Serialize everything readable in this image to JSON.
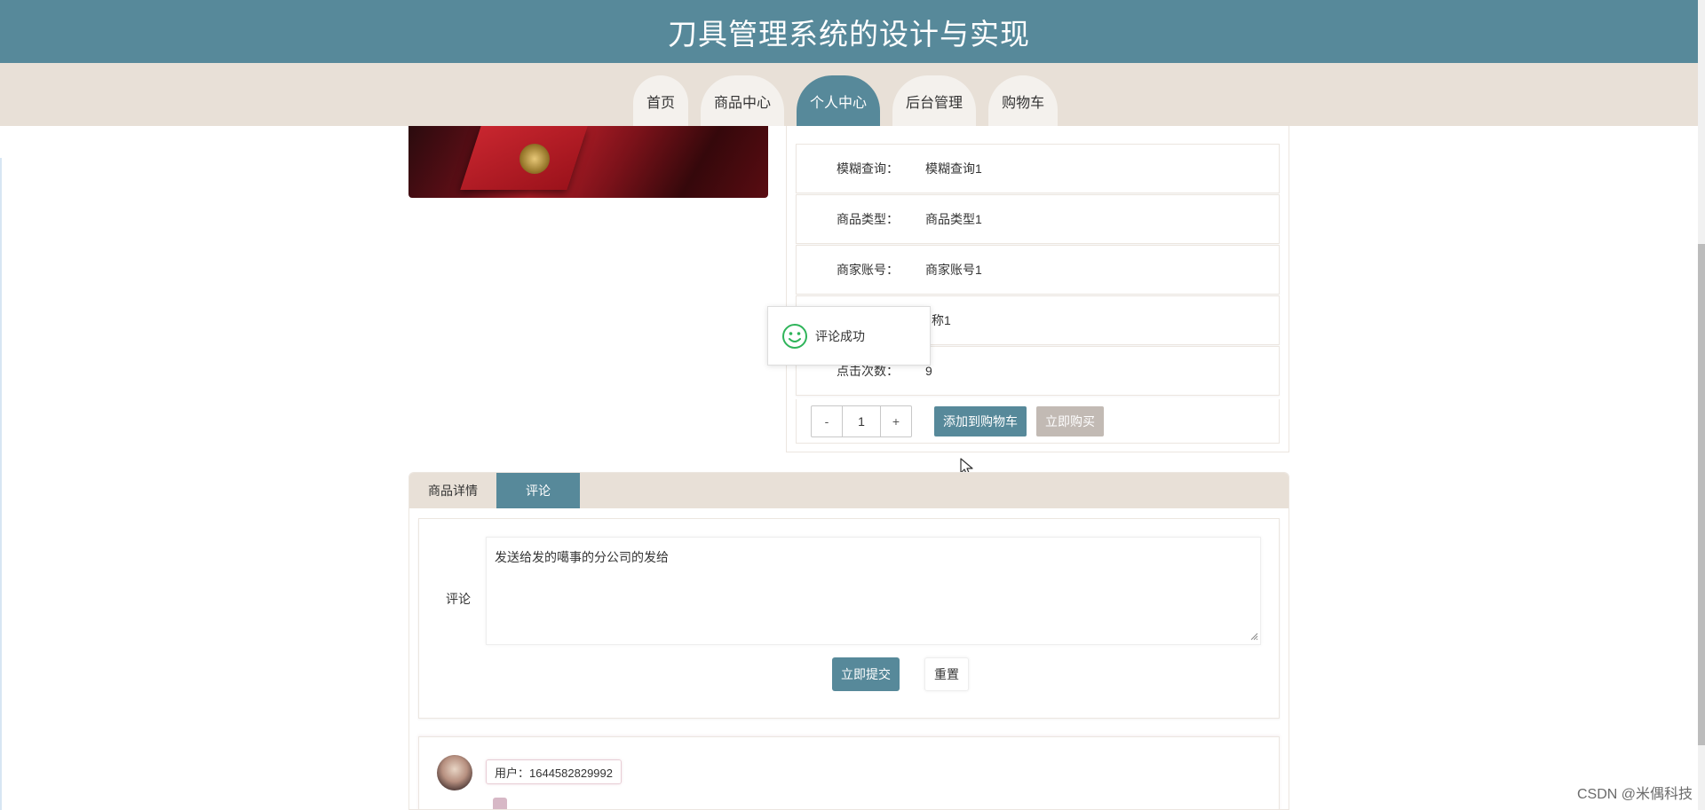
{
  "header": {
    "title": "刀具管理系统的设计与实现"
  },
  "nav": {
    "tabs": [
      {
        "label": "首页"
      },
      {
        "label": "商品中心"
      },
      {
        "label": "个人中心"
      },
      {
        "label": "后台管理"
      },
      {
        "label": "购物车"
      }
    ],
    "active_tab": "个人中心"
  },
  "product": {
    "fields": [
      {
        "label": "模糊查询：",
        "value": "模糊查询1"
      },
      {
        "label": "商品类型：",
        "value": "商品类型1"
      },
      {
        "label": "商家账号：",
        "value": "商家账号1"
      },
      {
        "label": "",
        "value": "家名称1"
      },
      {
        "label": "点击次数：",
        "value": "9"
      }
    ],
    "quantity": "1",
    "minus_label": "-",
    "plus_label": "+",
    "add_to_cart_label": "添加到购物车",
    "buy_now_label": "立即购买"
  },
  "toast": {
    "message": "评论成功"
  },
  "tabs": {
    "items": [
      {
        "label": "商品详情"
      },
      {
        "label": "评论"
      }
    ],
    "active": "评论"
  },
  "comment_form": {
    "label": "评论",
    "text": "发送给发的噶事的分公司的发给",
    "submit_label": "立即提交",
    "reset_label": "重置"
  },
  "comments": [
    {
      "user": "用户：1644582829992"
    }
  ],
  "watermark": "CSDN @米偶科技",
  "colors": {
    "primary": "#57899a",
    "nav_bg": "#e8e0d7",
    "toast_icon": "#2fb45a",
    "disabled": "#c2bab4"
  }
}
